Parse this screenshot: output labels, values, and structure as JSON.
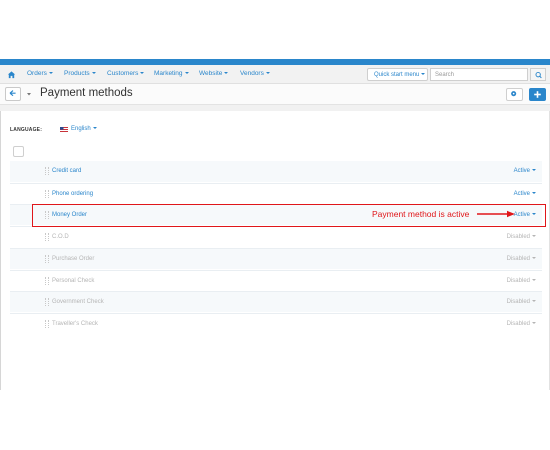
{
  "nav": {
    "items": [
      {
        "label": "Orders"
      },
      {
        "label": "Products"
      },
      {
        "label": "Customers"
      },
      {
        "label": "Marketing"
      },
      {
        "label": "Website"
      },
      {
        "label": "Vendors"
      }
    ],
    "quick_start_label": "Quick start menu",
    "search_placeholder": "Search",
    "icons": {
      "home": "home-icon",
      "search": "search-icon"
    }
  },
  "header": {
    "title": "Payment methods",
    "icons": {
      "back": "arrow-left-icon",
      "dropdown": "caret-down-icon",
      "help": "gear-icon",
      "add": "plus-icon"
    }
  },
  "language": {
    "label": "LANGUAGE:",
    "value": "English",
    "flag_icon": "us-flag-icon"
  },
  "methods": [
    {
      "name": "Credit card",
      "status": "Active"
    },
    {
      "name": "Phone ordering",
      "status": "Active"
    },
    {
      "name": "Money Order",
      "status": "Active"
    },
    {
      "name": "C.O.D",
      "status": "Disabled"
    },
    {
      "name": "Purchase Order",
      "status": "Disabled"
    },
    {
      "name": "Personal Check",
      "status": "Disabled"
    },
    {
      "name": "Government Check",
      "status": "Disabled"
    },
    {
      "name": "Traveller's Check",
      "status": "Disabled"
    }
  ],
  "annotation": {
    "text": "Payment method is active",
    "color": "#e0161a"
  },
  "colors": {
    "accent": "#2a86cb",
    "disabled_text": "#b5b5b5",
    "annotation": "#e0161a"
  }
}
